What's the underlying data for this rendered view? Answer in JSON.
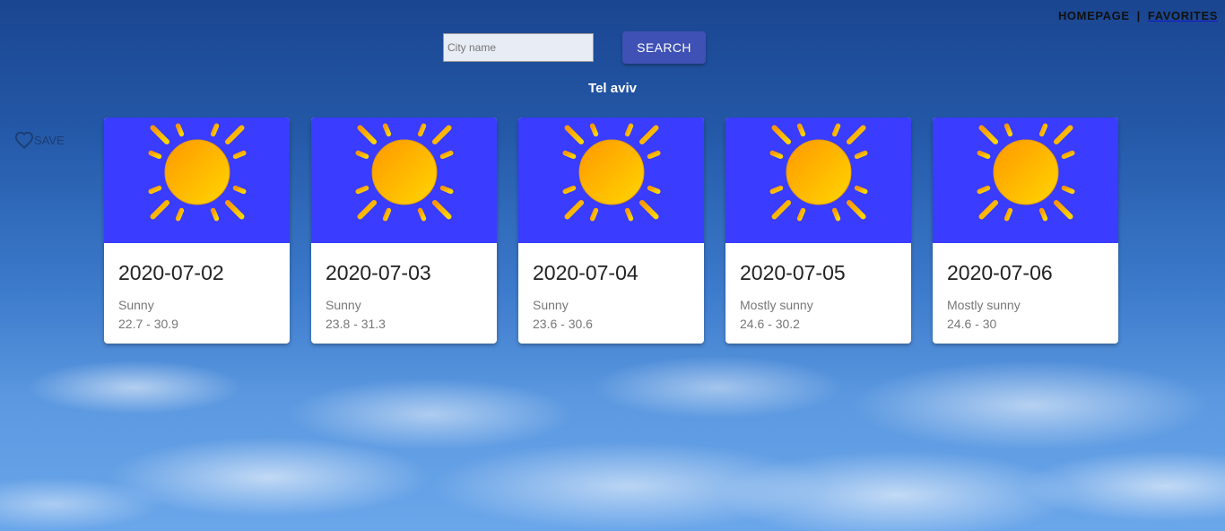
{
  "nav": {
    "homepage": "HOMEPAGE",
    "separator": "|",
    "favorites": "FAVORITES"
  },
  "search": {
    "placeholder": "City name",
    "value": "",
    "button": "SEARCH"
  },
  "city": "Tel aviv",
  "save_label": "SAVE",
  "forecast": [
    {
      "date": "2020-07-02",
      "desc": "Sunny",
      "range": "22.7 - 30.9",
      "icon": "sun-icon"
    },
    {
      "date": "2020-07-03",
      "desc": "Sunny",
      "range": "23.8 - 31.3",
      "icon": "sun-icon"
    },
    {
      "date": "2020-07-04",
      "desc": "Sunny",
      "range": "23.6 - 30.6",
      "icon": "sun-icon"
    },
    {
      "date": "2020-07-05",
      "desc": "Mostly sunny",
      "range": "24.6 - 30.2",
      "icon": "sun-icon"
    },
    {
      "date": "2020-07-06",
      "desc": "Mostly sunny",
      "range": "24.6 - 30",
      "icon": "sun-icon"
    }
  ],
  "colors": {
    "card_image_bg": "#3a3cff",
    "button": "#3f51b5",
    "sun": "#ffb300"
  }
}
